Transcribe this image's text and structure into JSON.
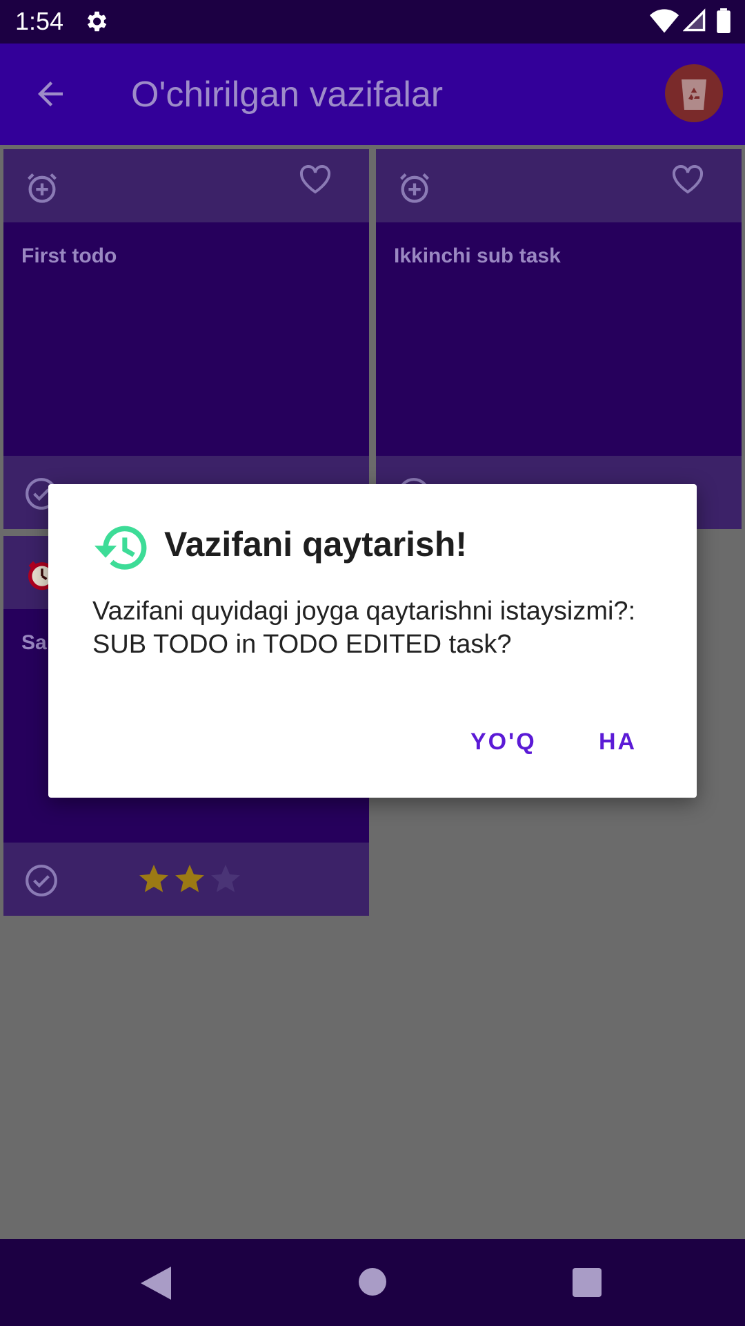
{
  "status_bar": {
    "time": "1:54",
    "icons": [
      "gear-icon",
      "wifi-icon",
      "signal-icon",
      "battery-icon"
    ]
  },
  "app_bar": {
    "title": "O'chirilgan vazifalar",
    "back_icon": "arrow-back-icon",
    "action_icon": "trash-recycle-icon",
    "background": "#330099"
  },
  "cards": [
    {
      "title": "First todo",
      "icons": [
        "alarm-add-icon",
        "heart-outline-icon",
        "check-circle-icon"
      ]
    },
    {
      "title": "Ikkinchi sub task",
      "icons": [
        "alarm-add-icon",
        "heart-outline-icon",
        "check-circle-icon"
      ]
    },
    {
      "title": "Sa",
      "icons": [
        "alarm-clock-icon",
        "check-circle-icon"
      ],
      "rating": 2,
      "rating_max": 3
    }
  ],
  "dialog": {
    "icon": "restore-history-icon",
    "title": "Vazifani qaytarish!",
    "message": "Vazifani quyidagi joyga qaytarishni istaysizmi?: SUB TODO in TODO EDITED task?",
    "buttons": {
      "no": "YO'Q",
      "yes": "HA"
    },
    "accent": "#5b1ad6",
    "icon_color": "#3ddc97"
  },
  "nav_bar": {
    "icons": [
      "nav-back-icon",
      "nav-home-icon",
      "nav-recents-icon"
    ]
  }
}
